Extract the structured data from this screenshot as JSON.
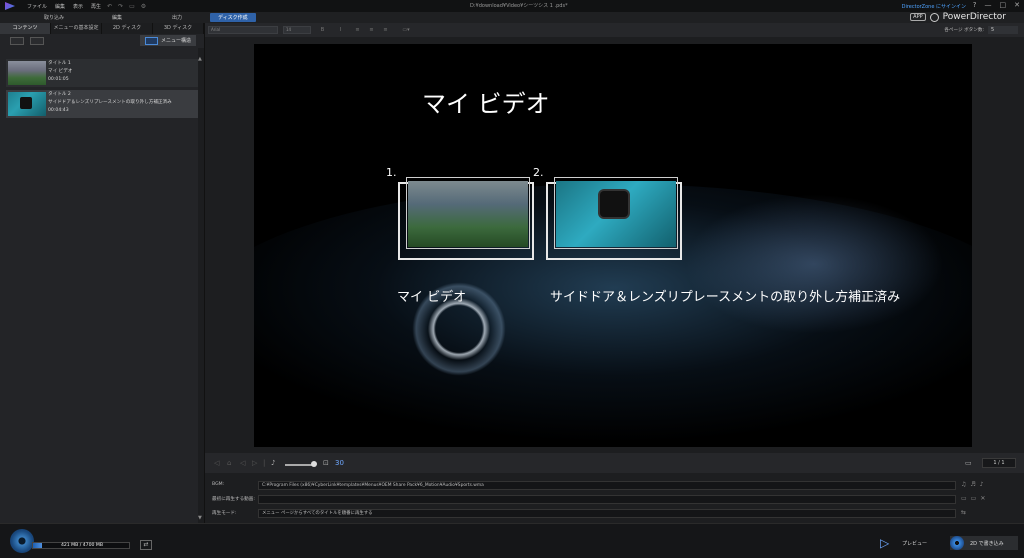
{
  "titlebar": {
    "menus": [
      "ファイル",
      "編集",
      "表示",
      "再生"
    ],
    "document_title": "D:¥download¥Video¥シーツシス 1 .pds*",
    "director_link": "DirectorZone にサインイン",
    "window_controls": [
      "?",
      "—",
      "□",
      "✕"
    ]
  },
  "modebar": {
    "tabs": [
      "取り込み",
      "編集",
      "出力",
      "ディスク作成"
    ],
    "active_tab": "ディスク作成",
    "brand_badge": "APP",
    "brand_name": "PowerDirector"
  },
  "left_panel": {
    "subtabs": [
      "コンテンツ",
      "メニューの基本設定",
      "2D ディスク",
      "3D ディスク"
    ],
    "active_subtab": "コンテンツ",
    "menu_create_label": "メニュー構造",
    "titles": [
      {
        "name": "タイトル 1",
        "subtitle": "マイ ビデオ",
        "duration": "00:01:05"
      },
      {
        "name": "タイトル 2",
        "subtitle": "サイドドア＆レンズリプレースメントの取り外し方補正済み",
        "duration": "00:04:43"
      }
    ]
  },
  "format_toolbar": {
    "font_name": "Arial",
    "font_size": "14",
    "per_page_label": "各ページ ボタン数:",
    "per_page_value": "5"
  },
  "canvas": {
    "menu_title": "マイ ビデオ",
    "buttons": [
      {
        "number": "1.",
        "caption": "マイ ビデオ"
      },
      {
        "number": "2.",
        "caption": "サイドドア＆レンズリプレースメントの取り外し方補正済み"
      }
    ]
  },
  "playbar": {
    "page_counter": "1 / 1",
    "zoom_value": "30"
  },
  "properties": {
    "bgm_label": "BGM:",
    "bgm_value": "C:¥Program Files (x86)¥CyberLink¥templates¥Menus¥OEM Share Pack¥6_Motion¥Audio¥Sports.wma",
    "first_play_label": "最初に再生する動画:",
    "first_play_value": "",
    "playback_mode_label": "再生モード:",
    "playback_mode_value": "メニュー ページからすべてのタイトルを順番に再生する"
  },
  "bottombar": {
    "capacity_text": "421 MB / 4700 MB",
    "capacity_fraction": 0.0896,
    "preview_label": "プレビュー",
    "burn_label": "2D で書き込み"
  }
}
